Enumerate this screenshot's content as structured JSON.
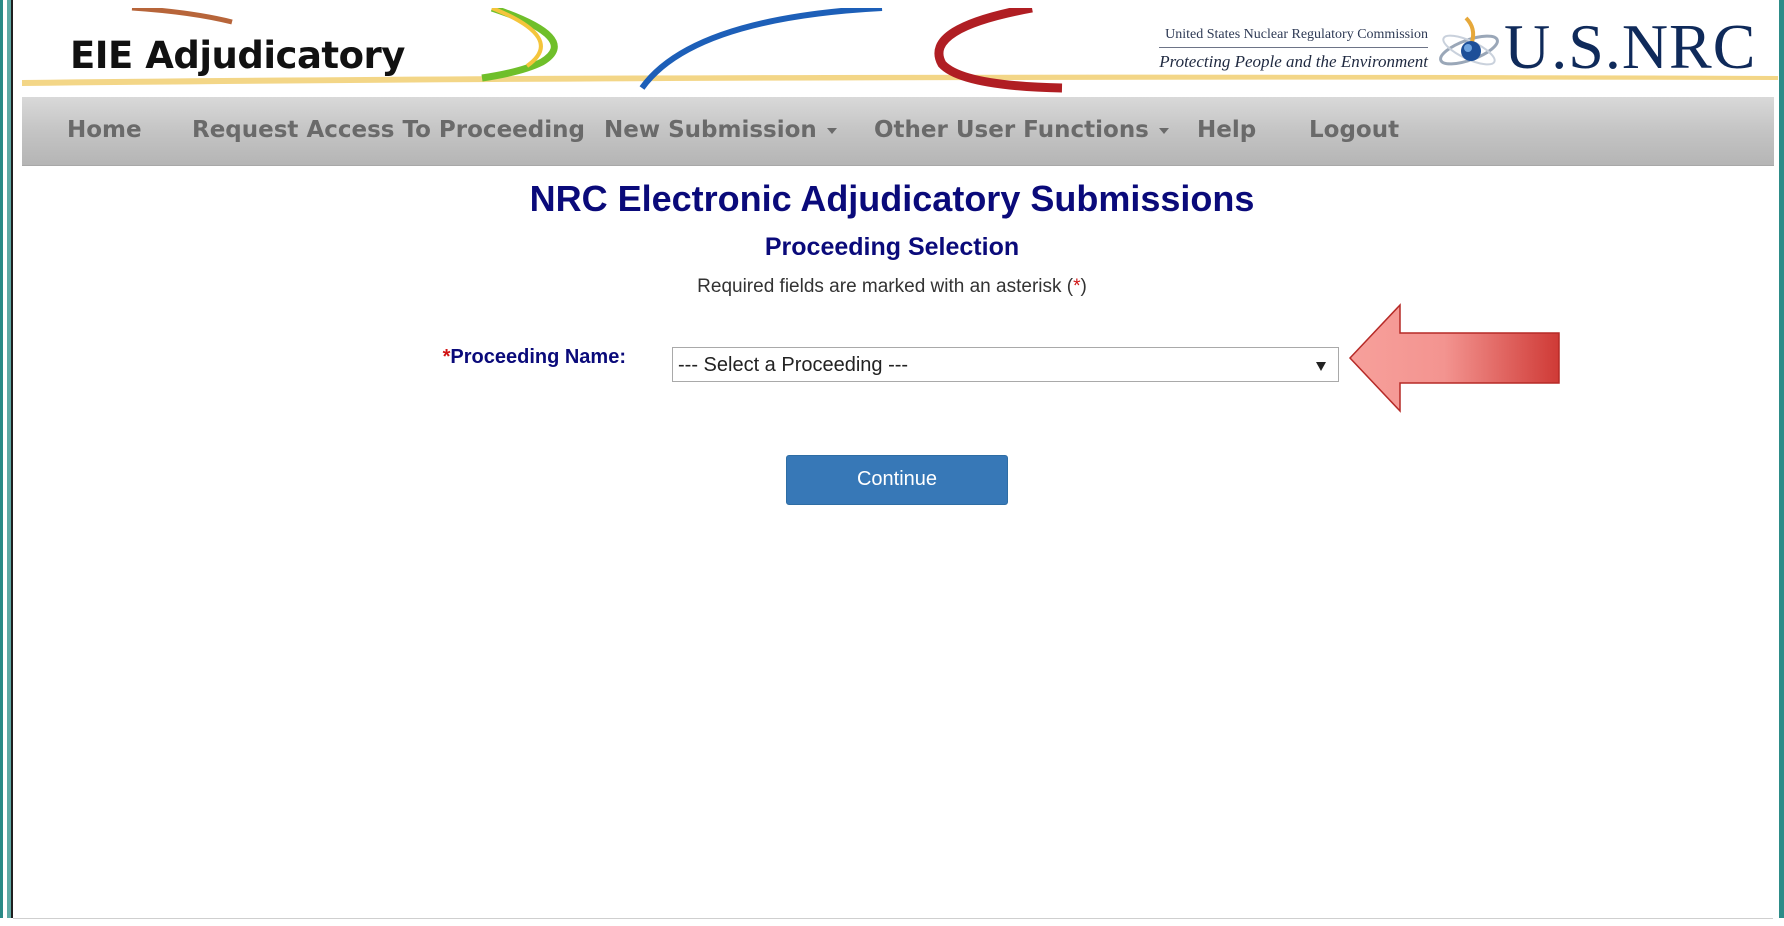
{
  "banner": {
    "app_title": "EIE Adjudicatory",
    "agency_name": "United States Nuclear Regulatory Commission",
    "agency_tagline": "Protecting People and the Environment",
    "logo_text": "U.S.NRC"
  },
  "nav": {
    "items": [
      {
        "label": "Home",
        "dropdown": false
      },
      {
        "label": "Request Access To Proceeding",
        "dropdown": false
      },
      {
        "label": "New Submission",
        "dropdown": true
      },
      {
        "label": "Other User Functions",
        "dropdown": true
      },
      {
        "label": "Help",
        "dropdown": false
      },
      {
        "label": "Logout",
        "dropdown": false
      }
    ]
  },
  "main": {
    "title": "NRC Electronic Adjudicatory Submissions",
    "subtitle": "Proceeding Selection",
    "required_note_prefix": "Required fields are marked with an asterisk (",
    "required_note_asterisk": "*",
    "required_note_suffix": ")",
    "proceeding_field": {
      "asterisk": "*",
      "label": "Proceeding Name:",
      "selected_value": "--- Select a Proceeding ---"
    },
    "continue_label": "Continue"
  },
  "colors": {
    "heading": "#0a0a7a",
    "required": "#d11414",
    "button": "#3778b7",
    "nav_text": "#6a6a6a",
    "callout_arrow": "#d9403c"
  },
  "icons": {
    "logo": "nrc-atom-logo-icon",
    "select_arrow": "triangle-down-icon",
    "callout": "left-arrow-callout-icon"
  }
}
